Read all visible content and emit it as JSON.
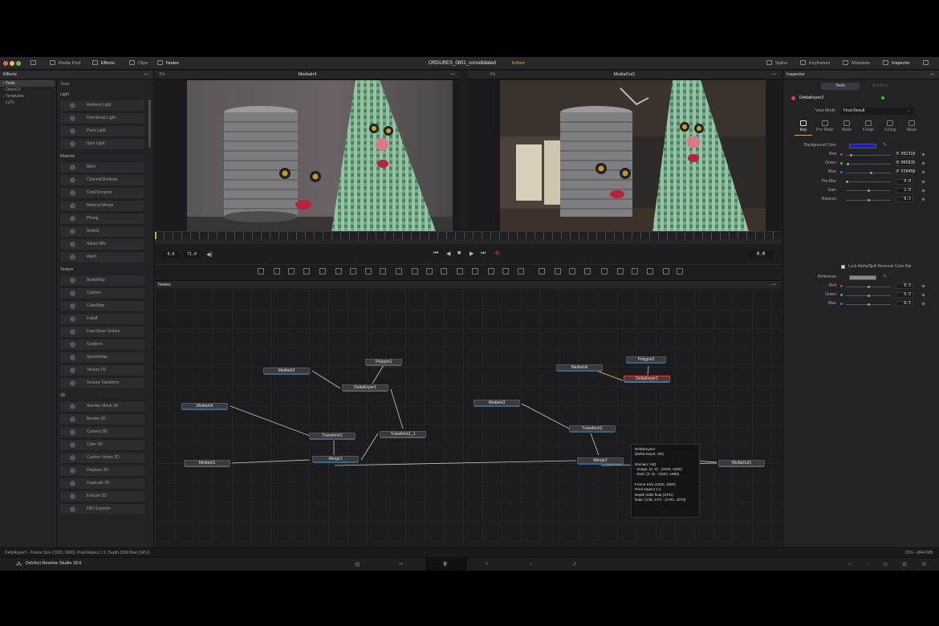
{
  "app": {
    "title": "ORDURES_0801_consolidated",
    "edited": "Edited",
    "brand": "DaVinci Resolve Studio 18.6"
  },
  "topbar": {
    "left": [
      "Media Pool",
      "Effects",
      "Clips",
      "Nodes"
    ],
    "right": [
      "Spline",
      "Keyframes",
      "Metadata",
      "Inspector"
    ]
  },
  "effects": {
    "panel_title": "Effects",
    "tree": [
      "Tools",
      "OpenFX",
      "Templates",
      "LUTs"
    ],
    "list_header": "Tools",
    "categories": [
      {
        "name": "Light",
        "items": [
          "Ambient Light",
          "Directional Light",
          "Point Light",
          "Spot Light"
        ]
      },
      {
        "name": "Material",
        "items": [
          "Blinn",
          "Channel Boolean",
          "CookTorrance",
          "Material Merge",
          "Phong",
          "Reflect",
          "Stereo Mix",
          "Ward"
        ]
      },
      {
        "name": "Texture",
        "items": [
          "BumpMap",
          "Catcher",
          "CubeMap",
          "Falloff",
          "Fast Noise Texture",
          "Gradient",
          "SphereMap",
          "Texture 2D",
          "Texture Transform"
        ]
      },
      {
        "name": "3D",
        "items": [
          "Alembic Mesh 3D",
          "Bender 3D",
          "Camera 3D",
          "Cube 3D",
          "Custom Vertex 3D",
          "Displace 3D",
          "Duplicate 3D",
          "Extrude 3D",
          "FBX Exporter"
        ]
      }
    ]
  },
  "viewer_left": {
    "fit": "Fit",
    "title": "MediaIn4"
  },
  "viewer_right": {
    "fit": "Fit",
    "title": "MediaOut1"
  },
  "transport": {
    "in": "0.0",
    "out": "71.0",
    "current": "0.0"
  },
  "node_editor": {
    "title": "Nodes",
    "nodes": {
      "polygon1": "Polygon1",
      "mediain2": "MediaIn2",
      "deltakeyer1": "DeltaKeyer1",
      "mediain4": "MediaIn4",
      "transform1": "Transform1",
      "transform1_1": "Transform1_1",
      "mediain1": "MediaIn1",
      "merge1": "Merge1",
      "polygon2": "Polygon2",
      "mediain6": "MediaIn6",
      "deltakeyer2": "DeltaKeyer2",
      "mediain3": "MediaIn3",
      "transform2": "Transform2",
      "merge2": "Merge2",
      "mediaout1": "MediaOut1"
    },
    "tooltip": [
      "DeltaKeyer2",
      "(Delta Keyer, OK)",
      "",
      "Domain: HiQ",
      "  Image: (0, 0) - (1920, 1080)",
      "  DoD: (0, 0) - (1920, 1080)",
      "",
      "Frame Size (1920, 1080)",
      "Pixel Aspect 1:1",
      "Depth 32bit float (GPU)",
      "Data: (136, 147) - (1791, 1079)"
    ]
  },
  "inspector": {
    "title": "Inspector",
    "tabs": [
      "Tools",
      "Modifiers"
    ],
    "node_name": "DeltaKeyer2",
    "view_mode_label": "View Mode",
    "view_mode_value": "Final Result",
    "subtabs": [
      "Key",
      "Pre Matte",
      "Matte",
      "Fringe",
      "Tuning",
      "Mask"
    ],
    "background_color_label": "Background Color",
    "background_color": "#1c1ad1",
    "rows": [
      {
        "label": "Red",
        "value": "0.092319",
        "dot": "#e03a3a",
        "level": 0.09
      },
      {
        "label": "Green",
        "value": "0.005826",
        "dot": "#3ac03a",
        "level": 0.01
      },
      {
        "label": "Blue",
        "value": "0.558458",
        "dot": "#3a6ae0",
        "level": 0.56
      },
      {
        "label": "Pre-Blur",
        "value": "0.0",
        "dot": "",
        "level": 0.0
      },
      {
        "label": "Gain",
        "value": "1.0",
        "dot": "",
        "level": 0.5
      },
      {
        "label": "Balance",
        "value": "0.5",
        "dot": "",
        "level": 0.5
      }
    ],
    "lock_label": "Lock Alpha/Spill Removal Color Bal",
    "reference_label": "Reference",
    "ref_rows": [
      {
        "label": "Red",
        "value": "0.5",
        "dot": "#e03a3a",
        "level": 0.5
      },
      {
        "label": "Green",
        "value": "0.5",
        "dot": "#3ac03a",
        "level": 0.5
      },
      {
        "label": "Blue",
        "value": "0.5",
        "dot": "#3a6ae0",
        "level": 0.5
      }
    ]
  },
  "status": {
    "left": "DeltaKeyer2 - Frame Size (1920, 1080), Pixel Aspect 1:1, Depth 32bit float (GPU)",
    "right": "15% - 4944 MB"
  },
  "colors": {
    "accent_edited": "#d6a33d",
    "highlight_node": "#e0433a"
  }
}
